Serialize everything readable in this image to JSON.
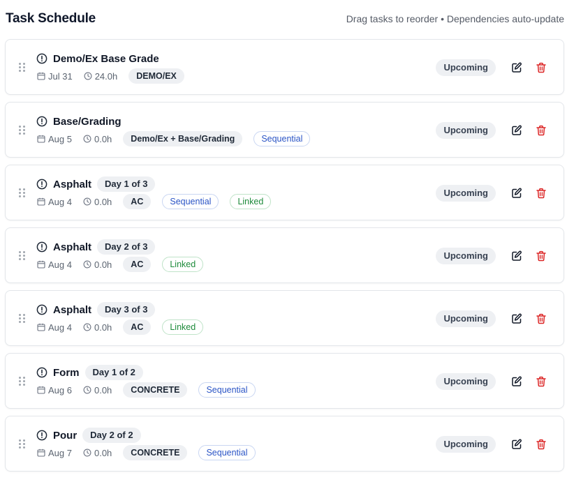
{
  "header": {
    "title": "Task Schedule",
    "hint": "Drag tasks to reorder • Dependencies auto-update"
  },
  "colors": {
    "delete": "#dc2626",
    "sequential": "#2b55c6",
    "linked": "#1d8a3a"
  },
  "tasks": [
    {
      "name": "Demo/Ex Base Grade",
      "day": "",
      "date": "Jul 31",
      "hours": "24.0h",
      "crew": "DEMO/EX",
      "sequential": "",
      "linked": "",
      "status": "Upcoming"
    },
    {
      "name": "Base/Grading",
      "day": "",
      "date": "Aug 5",
      "hours": "0.0h",
      "crew": "Demo/Ex + Base/Grading",
      "sequential": "Sequential",
      "linked": "",
      "status": "Upcoming"
    },
    {
      "name": "Asphalt",
      "day": "Day 1 of 3",
      "date": "Aug 4",
      "hours": "0.0h",
      "crew": "AC",
      "sequential": "Sequential",
      "linked": "Linked",
      "status": "Upcoming"
    },
    {
      "name": "Asphalt",
      "day": "Day 2 of 3",
      "date": "Aug 4",
      "hours": "0.0h",
      "crew": "AC",
      "sequential": "",
      "linked": "Linked",
      "status": "Upcoming"
    },
    {
      "name": "Asphalt",
      "day": "Day 3 of 3",
      "date": "Aug 4",
      "hours": "0.0h",
      "crew": "AC",
      "sequential": "",
      "linked": "Linked",
      "status": "Upcoming"
    },
    {
      "name": "Form",
      "day": "Day 1 of 2",
      "date": "Aug 6",
      "hours": "0.0h",
      "crew": "CONCRETE",
      "sequential": "Sequential",
      "linked": "",
      "status": "Upcoming"
    },
    {
      "name": "Pour",
      "day": "Day 2 of 2",
      "date": "Aug 7",
      "hours": "0.0h",
      "crew": "CONCRETE",
      "sequential": "Sequential",
      "linked": "",
      "status": "Upcoming"
    }
  ]
}
